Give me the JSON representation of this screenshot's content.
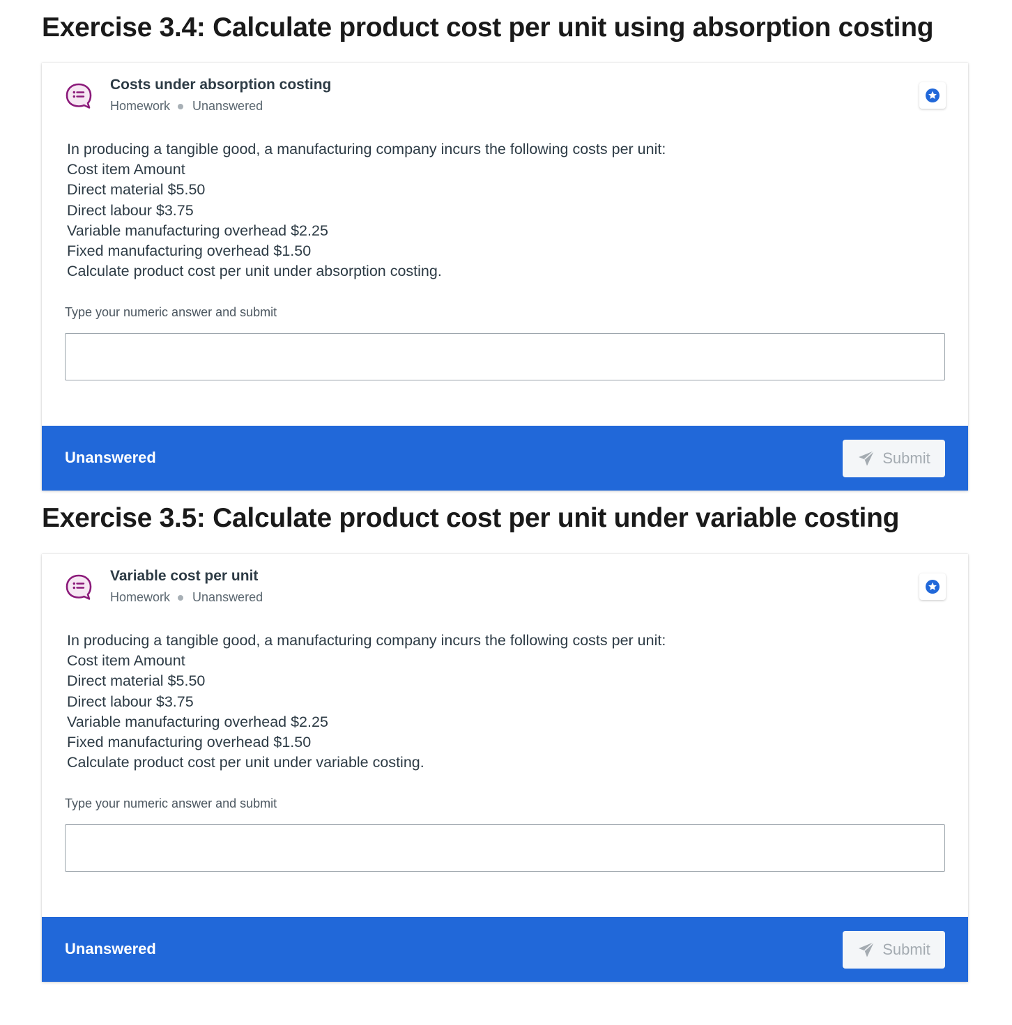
{
  "colors": {
    "footer_blue": "#2168d9",
    "icon_purple": "#8b1a7a",
    "bookmark_blue": "#2168d9",
    "disabled_text": "#a4abb1"
  },
  "exercises": [
    {
      "heading": "Exercise 3.4: Calculate product cost per unit using absorption costing",
      "card": {
        "icon": "discussion-question-icon",
        "title": "Costs under absorption costing",
        "meta_type": "Homework",
        "meta_status": "Unanswered",
        "bookmark_icon": "star-bookmark-icon",
        "body_lines": [
          "In producing a tangible good, a manufacturing company incurs the following costs per unit:",
          "Cost item Amount",
          "Direct material $5.50",
          "Direct labour $3.75",
          "Variable manufacturing overhead $2.25",
          "Fixed manufacturing overhead $1.50",
          "Calculate product cost per unit under absorption costing."
        ],
        "answer_label": "Type your numeric answer and submit",
        "answer_value": "",
        "footer_status": "Unanswered",
        "submit_label": "Submit",
        "submit_icon": "paper-plane-icon"
      }
    },
    {
      "heading": "Exercise 3.5: Calculate product cost per unit under variable costing",
      "card": {
        "icon": "discussion-question-icon",
        "title": "Variable cost per unit",
        "meta_type": "Homework",
        "meta_status": "Unanswered",
        "bookmark_icon": "star-bookmark-icon",
        "body_lines": [
          "In producing a tangible good, a manufacturing company incurs the following costs per unit:",
          "Cost item Amount",
          "Direct material $5.50",
          "Direct labour $3.75",
          "Variable manufacturing overhead $2.25",
          "Fixed manufacturing overhead $1.50",
          "Calculate product cost per unit under variable costing."
        ],
        "answer_label": "Type your numeric answer and submit",
        "answer_value": "",
        "footer_status": "Unanswered",
        "submit_label": "Submit",
        "submit_icon": "paper-plane-icon"
      }
    }
  ]
}
